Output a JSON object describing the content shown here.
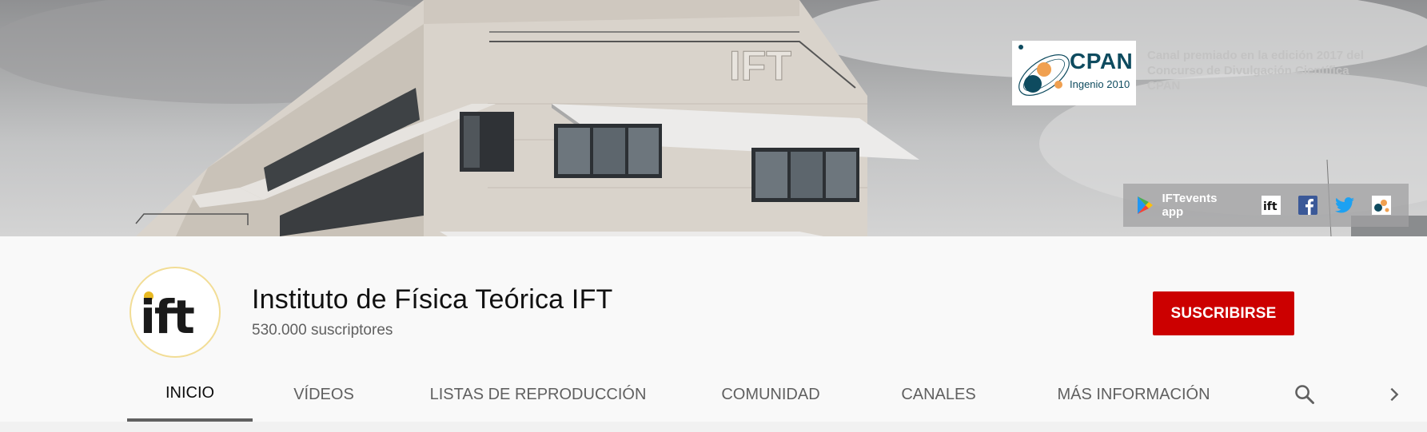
{
  "banner": {
    "building_sign": "IFT",
    "cpan_logo": {
      "word": "CPAN",
      "subtitle": "Ingenio 2010"
    },
    "award_lines": [
      "Canal premiado en la edición 2017 del",
      "Concurso de Divulgación Científica",
      "CPAN"
    ],
    "links": {
      "app_label": "IFTevents app",
      "icons": [
        "ift-logo-icon",
        "facebook-icon",
        "twitter-icon",
        "web-icon"
      ]
    }
  },
  "channel": {
    "avatar_text": "ift",
    "name": "Instituto de Física Teórica IFT",
    "subscribers": "530.000 suscriptores",
    "subscribe_label": "SUSCRIBIRSE"
  },
  "tabs": {
    "items": [
      {
        "label": "INICIO",
        "active": true
      },
      {
        "label": "VÍDEOS",
        "active": false
      },
      {
        "label": "LISTAS DE REPRODUCCIÓN",
        "active": false
      },
      {
        "label": "COMUNIDAD",
        "active": false
      },
      {
        "label": "CANALES",
        "active": false
      },
      {
        "label": "MÁS INFORMACIÓN",
        "active": false
      }
    ],
    "search_icon": "search-icon",
    "next_icon": "chevron-right-icon"
  },
  "colors": {
    "subscribe": "#cc0000",
    "cpan_text": "#0e4b5f",
    "active_tab_indicator": "#606060"
  }
}
